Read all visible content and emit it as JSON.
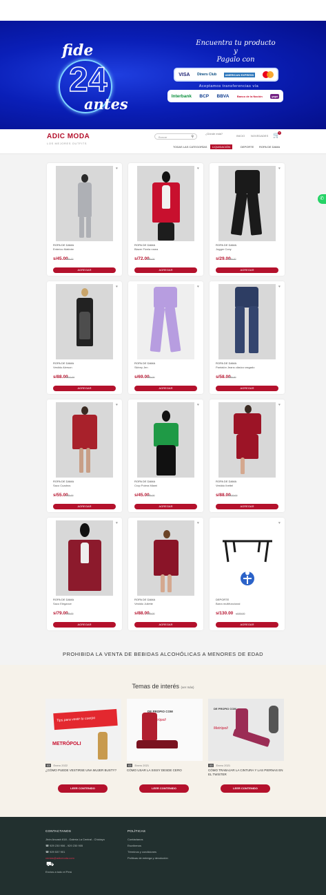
{
  "banner": {
    "logo_fide": "fide",
    "logo_number": "24",
    "logo_antes": "antes",
    "line1": "Encuentra tu producto",
    "line2": "y",
    "line3": "Pagalo con",
    "cards": [
      "VISA",
      "Diners Club",
      "AMERICAN EXPRESS",
      "mastercard"
    ],
    "transfer_text": "Aceptamos transferencias vía",
    "banks": [
      "Interbank",
      "BCP",
      "BBVA",
      "Banco de la Nación",
      "yape"
    ]
  },
  "header": {
    "brand": "ADIC MODA",
    "tagline": "LOS MEJORES OUTFITS",
    "search_placeholder": "Buscar",
    "location": "¿Dónde está?",
    "links": [
      "INICIO",
      "NOVEDADES"
    ],
    "cart_count": "0",
    "menu": [
      "TODAS LAS CATEGORÍAS",
      "LIQUIDACIÓN",
      "DEPORTE",
      "ROPA DE DAMA"
    ]
  },
  "products": [
    {
      "category": "ROPA DE DAMA",
      "name": "Enterizo Matinée",
      "price": "s/45.00",
      "old": "s/65.00",
      "button": "AGREGAR"
    },
    {
      "category": "ROPA DE DAMA",
      "name": "Blazer Fivela rosea",
      "price": "s/72.00",
      "old": "s/90.00",
      "button": "AGREGAR"
    },
    {
      "category": "ROPA DE DAMA",
      "name": "Jogger Cony",
      "price": "s/29.00",
      "old": "s/45.00",
      "button": "AGREGAR"
    },
    {
      "category": "ROPA DE DAMA",
      "name": "Vestido Alerson",
      "price": "s/88.00",
      "old": "s/110.00",
      "button": "AGREGAR"
    },
    {
      "category": "ROPA DE DAMA",
      "name": "Skinny Jen",
      "price": "s/69.00",
      "old": "s/79.00",
      "button": "AGREGAR"
    },
    {
      "category": "ROPA DE DAMA",
      "name": "Pantalón Jeans clásico rasgado",
      "price": "s/58.00",
      "old": "s/65.00",
      "button": "AGREGAR"
    },
    {
      "category": "ROPA DE DAMA",
      "name": "Saco Cuadros",
      "price": "s/55.00",
      "old": "s/65.00",
      "button": "AGREGAR"
    },
    {
      "category": "ROPA DE DAMA",
      "name": "Crop Polera Miami",
      "price": "s/45.00",
      "old": "s/55.00",
      "button": "AGREGAR"
    },
    {
      "category": "ROPA DE DAMA",
      "name": "Vestido Ibettel",
      "price": "s/88.00",
      "old": "s/100.00",
      "button": "AGREGAR"
    },
    {
      "category": "ROPA DE DAMA",
      "name": "Saco Elegance",
      "price": "s/79.00",
      "old": "s/89.00",
      "button": "AGREGAR"
    },
    {
      "category": "ROPA DE DAMA",
      "name": "Vestido Juliette",
      "price": "s/88.00",
      "old": "s/99.00",
      "button": "AGREGAR"
    },
    {
      "category": "DEPORTE",
      "name": "Barra multifuncional",
      "price": "s/130.00",
      "old": "s/150.00",
      "button": "AGREGAR"
    }
  ],
  "notice": "PROHIBIDA LA VENTA DE BEBIDAS ALCOHÓLICAS A MENORES DE EDAD",
  "blog": {
    "title": "Temas de interés",
    "more": "(ver más)",
    "posts": [
      {
        "day": "03",
        "date": "Enero 2022",
        "title": "¿CÓMO PUEDE VESTIRSE UNA MUJER BUSTY?",
        "button": "LEER CONTENIDO",
        "img_text": "Tips para vestir tu cuerpo",
        "img_brand": "METRÓPOLI"
      },
      {
        "day": "03",
        "date": "Enero 2021",
        "title": "CÓMO USAR LA SISSY DESDE CERO",
        "button": "LEER CONTENIDO",
        "img_text": "DE PROPIO COM",
        "img_brand": "Metrópoli"
      },
      {
        "day": "03",
        "date": "Enero 2021",
        "title": "CÓMO TRABAJAR LA CINTURA Y LAS PIERNAS EN EL TWISTER",
        "button": "LEER CONTENIDO",
        "img_text": "DE PROPIO COM",
        "img_brand": "Metrópoli"
      }
    ]
  },
  "footer": {
    "contact_title": "CONTACTANOS",
    "address": "Jirón Ancash 618 - Galería La Central - Chiclayo",
    "phone1": "929 230 906 - 929 230 905",
    "phone2": "929 537 901",
    "email": "ventas@adicmoda.com",
    "shipping": "Envíos a todo el Perú",
    "policy_title": "POLÍTICAS",
    "policies": [
      "Contáctanos",
      "Escríbenos",
      "Términos y condiciones",
      "Políticas de entrega y devolución"
    ]
  },
  "colors": {
    "accent": "#b4112c",
    "banner": "#0a1fb8",
    "footer": "#22302f"
  }
}
